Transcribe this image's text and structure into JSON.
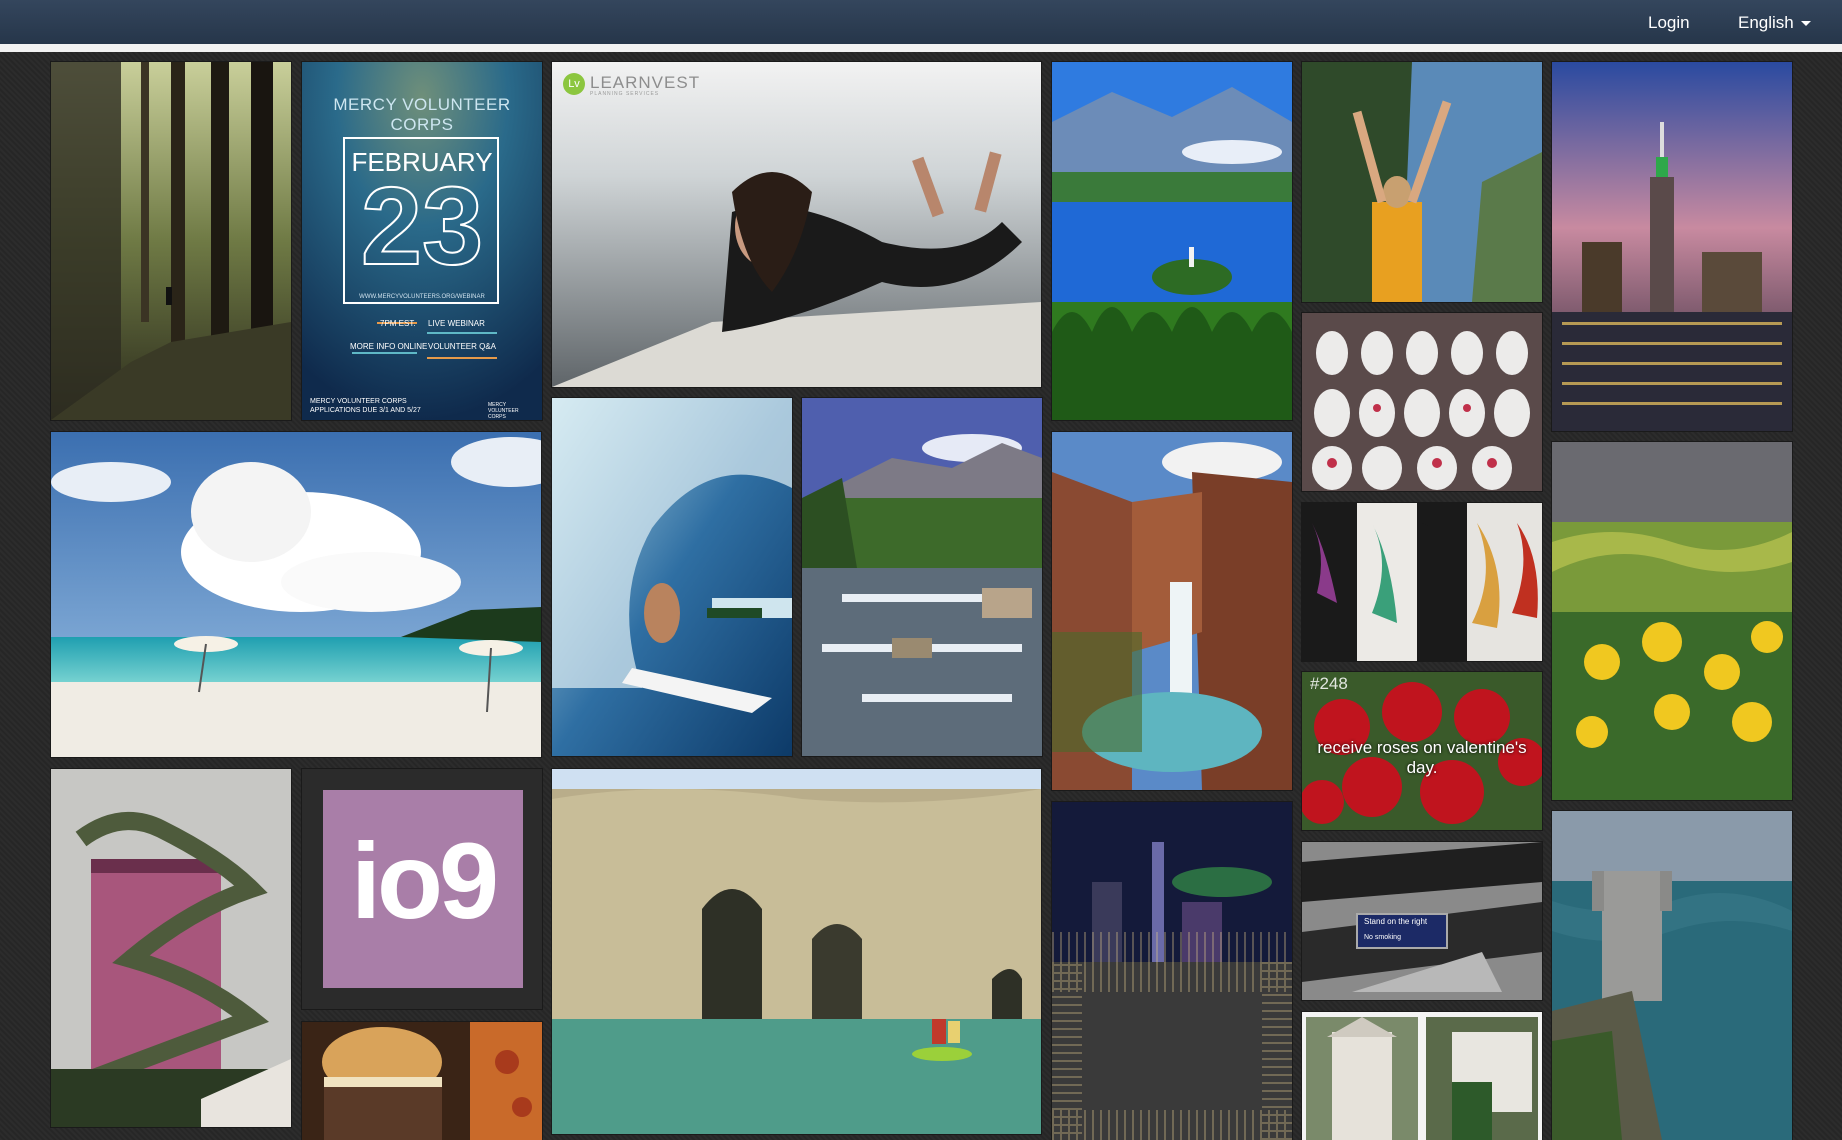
{
  "topbar": {
    "login_label": "Login",
    "language_label": "English"
  },
  "tiles": {
    "forest_path": {
      "icon": "forest-path-photo"
    },
    "poster": {
      "title": "MERCY VOLUNTEER CORPS",
      "month": "FEBRUARY",
      "day": "23",
      "url": "WWW.MERCYVOLUNTEERS.ORG/WEBINAR",
      "time": "7PM EST.",
      "webinar": "LIVE WEBINAR",
      "more_info": "MORE INFO ONLINE",
      "qa": "VOLUNTEER Q&A",
      "footer1": "MERCY VOLUNTEER CORPS",
      "footer2": "APPLICATIONS DUE 3/1 AND 5/27",
      "seal": "MERCY VOLUNTEER CORPS"
    },
    "learnvest": {
      "logo_badge": "Lv",
      "logo_text": "LEARNVEST",
      "logo_sub": "PLANNING SERVICES"
    },
    "valentines": {
      "number": "#248",
      "caption": "receive roses on valentine's day."
    },
    "escalator_sign": {
      "line1": "Stand on the right",
      "line2": "No smoking"
    },
    "io9": {
      "logo": "io9"
    }
  },
  "colors": {
    "topbar": "#2c3e55",
    "io9_purple": "#a97ea8",
    "poster_blue": "#1d3f6b"
  }
}
